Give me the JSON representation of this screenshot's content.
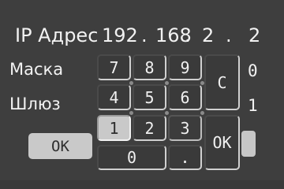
{
  "header": {
    "ip_label": "IP Адрес",
    "ip_octets": [
      "192",
      "168",
      "2",
      "2"
    ],
    "ip_separator": "."
  },
  "fields": {
    "mask_label": "Маска",
    "mask_value": "0",
    "gateway_label": "Шлюз",
    "gateway_value": "1"
  },
  "keypad": {
    "keys": [
      "7",
      "8",
      "9",
      "4",
      "5",
      "6",
      "1",
      "2",
      "3",
      "0",
      "."
    ],
    "clear_label": "C",
    "ok_label": "OK"
  },
  "left_ok_label": "OK"
}
